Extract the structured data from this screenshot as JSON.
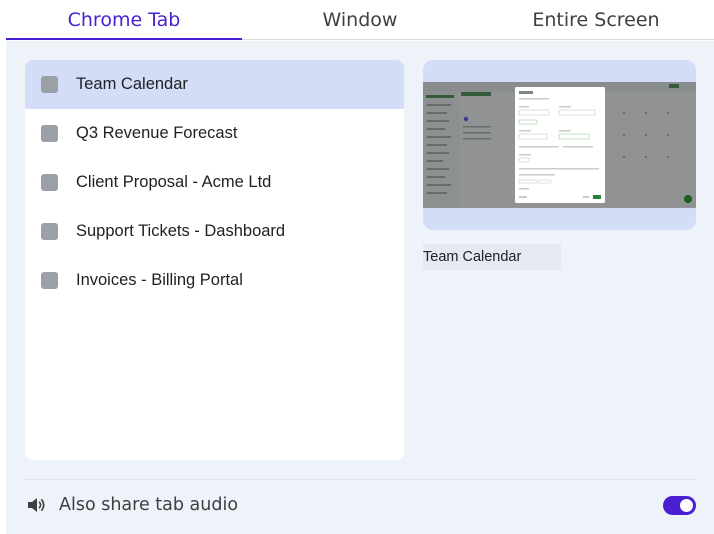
{
  "tabs": [
    {
      "label": "Chrome Tab",
      "active": true
    },
    {
      "label": "Window",
      "active": false
    },
    {
      "label": "Entire Screen",
      "active": false
    }
  ],
  "tab_list": {
    "items": [
      {
        "label": "Team Calendar",
        "selected": true,
        "icon": "favicon-placeholder-icon"
      },
      {
        "label": "Q3 Revenue Forecast",
        "selected": false,
        "icon": "favicon-placeholder-icon"
      },
      {
        "label": "Client Proposal - Acme Ltd",
        "selected": false,
        "icon": "favicon-placeholder-icon"
      },
      {
        "label": "Support Tickets - Dashboard",
        "selected": false,
        "icon": "favicon-placeholder-icon"
      },
      {
        "label": "Invoices - Billing Portal",
        "selected": false,
        "icon": "favicon-placeholder-icon"
      }
    ]
  },
  "preview": {
    "title": "Team Calendar"
  },
  "audio": {
    "label": "Also share tab audio",
    "icon": "speaker-icon",
    "enabled": true
  },
  "colors": {
    "accent": "#4a1fd1",
    "selected_row": "#d3ddf7",
    "panel_bg": "#eef2f9"
  }
}
